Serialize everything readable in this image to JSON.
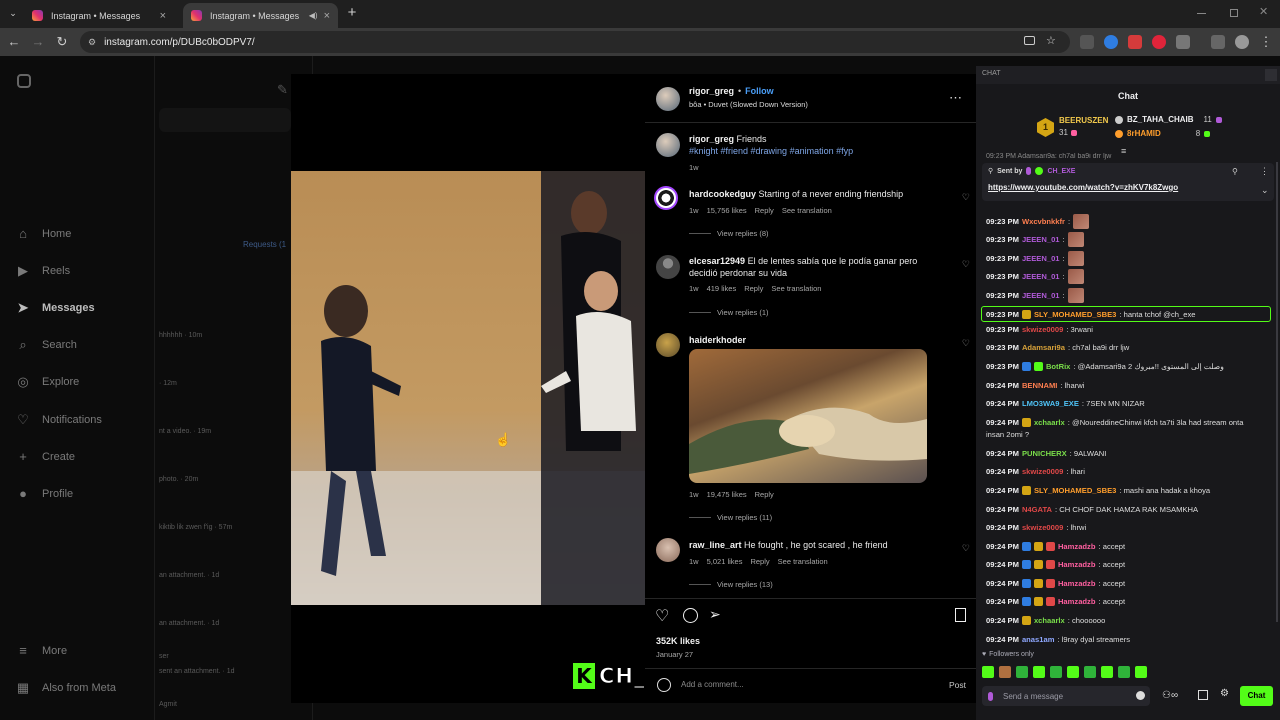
{
  "browser": {
    "tabs": [
      {
        "label": "Instagram • Messages",
        "active": false
      },
      {
        "label": "Instagram • Messages",
        "active": true
      }
    ],
    "new_tab": "+",
    "url": "instagram.com/p/DUBc0bODPV7/"
  },
  "sidebar": {
    "items": [
      {
        "label": "Home",
        "icon": "home-icon"
      },
      {
        "label": "Reels",
        "icon": "reels-icon"
      },
      {
        "label": "Messages",
        "icon": "messages-icon"
      },
      {
        "label": "Search",
        "icon": "search-icon"
      },
      {
        "label": "Explore",
        "icon": "explore-icon"
      },
      {
        "label": "Notifications",
        "icon": "heart-icon"
      },
      {
        "label": "Create",
        "icon": "plus-icon"
      },
      {
        "label": "Profile",
        "icon": "profile-icon"
      }
    ],
    "more": "More",
    "meta": "Also from Meta"
  },
  "dm_list": {
    "requests": "Requests (1",
    "items": [
      "hhhhhh · 10m",
      "· 12m",
      "nt a video. · 19m",
      "photo. · 20m",
      "kiktib lik zwen f'ig · 57m",
      "an attachment. · 1d",
      "an attachment. · 1d",
      "ser",
      "sent an attachment. · 1d",
      "Agmit"
    ]
  },
  "post": {
    "author": "rigor_greg",
    "follow": "Follow",
    "song": "bôa • Duvet (Slowed Down Version)",
    "caption_user": "rigor_greg",
    "caption_text": "Friends",
    "hashtags": "#knight #friend #drawing #animation #fyp",
    "caption_age": "1w",
    "comments": [
      {
        "user": "hardcookedguy",
        "text": "Starting of a never ending friendship",
        "meta": "1w",
        "likes": "15,756 likes",
        "reply": "Reply",
        "translate": "See translation",
        "replies": "View replies (8)"
      },
      {
        "user": "elcesar12949",
        "text": "El de lentes sabía que le podía ganar pero decidió perdonar su vida",
        "meta": "1w",
        "likes": "419 likes",
        "reply": "Reply",
        "translate": "See translation",
        "replies": "View replies (1)"
      },
      {
        "user": "haiderkhoder",
        "text": "",
        "meta": "1w",
        "likes": "19,475 likes",
        "reply": "Reply",
        "translate": "",
        "replies": "View replies (11)"
      },
      {
        "user": "raw_line_art",
        "text": "He fought , he got scared , he friend",
        "meta": "1w",
        "likes": "5,021 likes",
        "reply": "Reply",
        "translate": "See translation",
        "replies": "View replies (13)"
      }
    ],
    "likes": "352K likes",
    "date": "January 27",
    "comment_placeholder": "Add a comment...",
    "post_btn": "Post"
  },
  "overlay": {
    "streamer": "CH_EXE",
    "logo": "K"
  },
  "chat": {
    "header": "CHAT",
    "title": "Chat",
    "leaderboard": [
      {
        "rank": "1",
        "name": "BEERUSZEN",
        "score": "31"
      },
      {
        "name": "BZ_TAHA_CHAIB",
        "score": "11"
      },
      {
        "name": "8rHAMID",
        "score": "8"
      }
    ],
    "pinned_label": "Sent by",
    "pinned_by": "CH_EXE",
    "pinned_link": "https://www.youtube.com/watch?v=zhKV7k8Zwgo",
    "partial_top": "09:23 PM Adamsari9a: ch7al ba9i drr ljw",
    "messages": [
      {
        "time": "09:23 PM",
        "user": "Wxcvbnkkfr",
        "color": "#ff7f50",
        "text": ":",
        "emote": true
      },
      {
        "time": "09:23 PM",
        "user": "JEEEN_01",
        "color": "#b05ad8",
        "text": ":",
        "emote": true
      },
      {
        "time": "09:23 PM",
        "user": "JEEEN_01",
        "color": "#b05ad8",
        "text": ":",
        "emote": true
      },
      {
        "time": "09:23 PM",
        "user": "JEEEN_01",
        "color": "#b05ad8",
        "text": ":",
        "emote": true
      },
      {
        "time": "09:23 PM",
        "user": "JEEEN_01",
        "color": "#b05ad8",
        "text": ":",
        "emote": true
      },
      {
        "time": "09:23 PM",
        "user": "SLY_MOHAMED_SBE3",
        "color": "#ff9e2c",
        "text": ": hanta tchof @ch_exe",
        "highlight": true
      },
      {
        "time": "09:23 PM",
        "user": "skwize0009",
        "color": "#e04848",
        "text": ": 3rwani"
      },
      {
        "time": "09:23 PM",
        "user": "Adamsari9a",
        "color": "#d8a23a",
        "text": ": ch7al ba9i drr ljw"
      },
      {
        "time": "09:23 PM",
        "user": "BotRix",
        "color": "#7adf4a",
        "text": ": @Adamsari9a 2 وصلت إلى المستوى !!مبروك"
      },
      {
        "time": "09:24 PM",
        "user": "BENNAMI",
        "color": "#ff7f50",
        "text": ": lharwi"
      },
      {
        "time": "09:24 PM",
        "user": "LMO3WA9_EXE",
        "color": "#4fc3f7",
        "text": ": 7SEN MN NIZAR"
      },
      {
        "time": "09:24 PM",
        "user": "xchaarlx",
        "color": "#7adf4a",
        "text": ": @NoureddineChinwi kfch ta7ti 3la had stream onta",
        "wrap": "insan 2omi ?"
      },
      {
        "time": "09:24 PM",
        "user": "PUNICHERX",
        "color": "#7adf4a",
        "text": ": 9ALWANI"
      },
      {
        "time": "09:24 PM",
        "user": "skwize0009",
        "color": "#e04848",
        "text": ": lhari"
      },
      {
        "time": "09:24 PM",
        "user": "SLY_MOHAMED_SBE3",
        "color": "#ff9e2c",
        "text": ": mashi ana hadak a khoya"
      },
      {
        "time": "09:24 PM",
        "user": "N4GATA",
        "color": "#e04848",
        "text": ": CH CHOF DAK HAMZA RAK MSAMKHA"
      },
      {
        "time": "09:24 PM",
        "user": "skwize0009",
        "color": "#e04848",
        "text": ": lhrwi"
      },
      {
        "time": "09:24 PM",
        "user": "Hamzadzb",
        "color": "#ff5fa0",
        "text": ": accept"
      },
      {
        "time": "09:24 PM",
        "user": "Hamzadzb",
        "color": "#ff5fa0",
        "text": ": accept"
      },
      {
        "time": "09:24 PM",
        "user": "Hamzadzb",
        "color": "#ff5fa0",
        "text": ": accept"
      },
      {
        "time": "09:24 PM",
        "user": "Hamzadzb",
        "color": "#ff5fa0",
        "text": ": accept"
      },
      {
        "time": "09:24 PM",
        "user": "xchaarlx",
        "color": "#7adf4a",
        "text": ": choooooo"
      },
      {
        "time": "09:24 PM",
        "user": "anas1am",
        "color": "#8fa8ff",
        "text": ": l9ray dyal streamers"
      }
    ],
    "followers_only": "Followers only",
    "input_placeholder": "Send a message",
    "chat_button": "Chat"
  }
}
